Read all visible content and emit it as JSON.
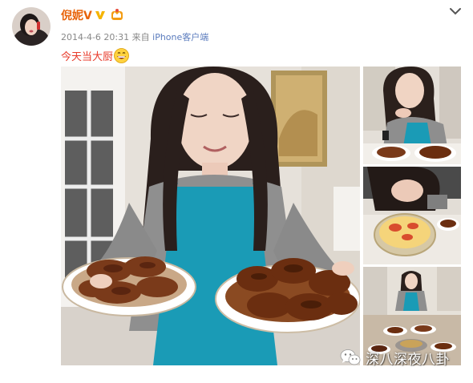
{
  "header": {
    "username": "倪妮V",
    "timestamp": "2014-4-6 20:31",
    "source_prefix": "来自",
    "source_client": "iPhone客户端"
  },
  "post": {
    "text": "今天当大厨",
    "emoji": "grin-emoji"
  },
  "icons": {
    "verified": "verified-v-icon",
    "level": "member-crown-icon",
    "menu": "chevron-down-icon"
  },
  "photos": [
    {
      "name": "main-photo",
      "description_label": ""
    },
    {
      "name": "thumb-1"
    },
    {
      "name": "thumb-2"
    },
    {
      "name": "thumb-3"
    }
  ],
  "watermark": {
    "text": "深八深夜八卦"
  },
  "colors": {
    "username": "#e8630a",
    "post_text": "#e83b2b",
    "client_link": "#5a7bbd",
    "apron": "#1a9bb6"
  }
}
